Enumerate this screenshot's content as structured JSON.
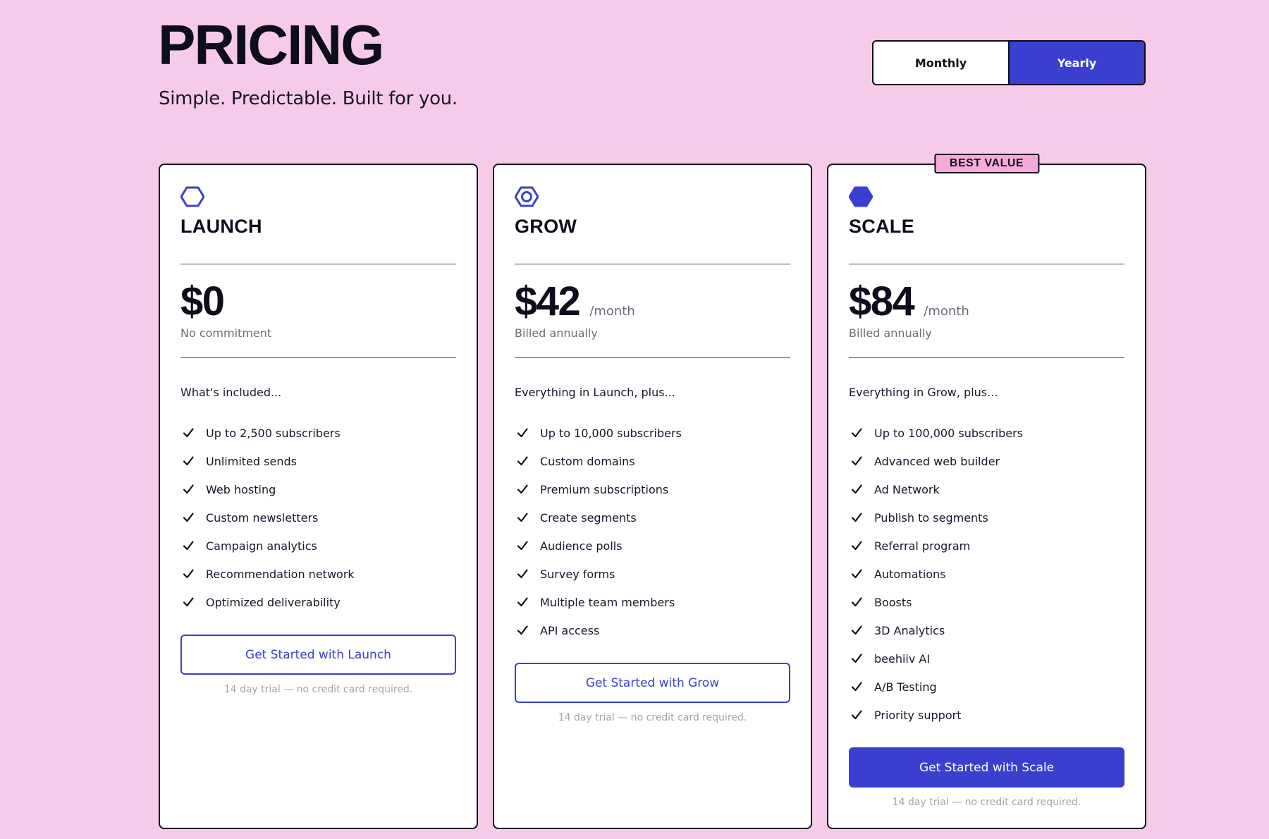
{
  "header": {
    "title": "PRICING",
    "subtitle": "Simple. Predictable. Built for you."
  },
  "billing_toggle": {
    "monthly_label": "Monthly",
    "yearly_label": "Yearly",
    "selected": "Yearly"
  },
  "colors": {
    "background": "#f6cbea",
    "accent": "#3b3fcf",
    "badge": "#f6a9dd"
  },
  "plans": [
    {
      "icon": "hexagon-outline-icon",
      "name": "LAUNCH",
      "price": "$0",
      "period": "",
      "billing": "No commitment",
      "intro": "What's included...",
      "features": [
        "Up to 2,500 subscribers",
        "Unlimited sends",
        "Web hosting",
        "Custom newsletters",
        "Campaign analytics",
        "Recommendation network",
        "Optimized deliverability"
      ],
      "cta": "Get Started with Launch",
      "note": "14 day trial — no credit card required."
    },
    {
      "icon": "hexagon-ring-icon",
      "name": "GROW",
      "price": "$42",
      "period": "/month",
      "billing": "Billed annually",
      "intro": "Everything in Launch, plus...",
      "features": [
        "Up to 10,000 subscribers",
        "Custom domains",
        "Premium subscriptions",
        "Create segments",
        "Audience polls",
        "Survey forms",
        "Multiple team members",
        "API access"
      ],
      "cta": "Get Started with Grow",
      "note": "14 day trial — no credit card required."
    },
    {
      "icon": "hexagon-filled-icon",
      "badge": "BEST VALUE",
      "name": "SCALE",
      "price": "$84",
      "period": "/month",
      "billing": "Billed annually",
      "intro": "Everything in Grow, plus...",
      "features": [
        "Up to 100,000 subscribers",
        "Advanced web builder",
        "Ad Network",
        "Publish to segments",
        "Referral program",
        "Automations",
        "Boosts",
        "3D Analytics",
        "beehiiv AI",
        "A/B Testing",
        "Priority support"
      ],
      "cta": "Get Started with Scale",
      "note": "14 day trial — no credit card required."
    }
  ]
}
